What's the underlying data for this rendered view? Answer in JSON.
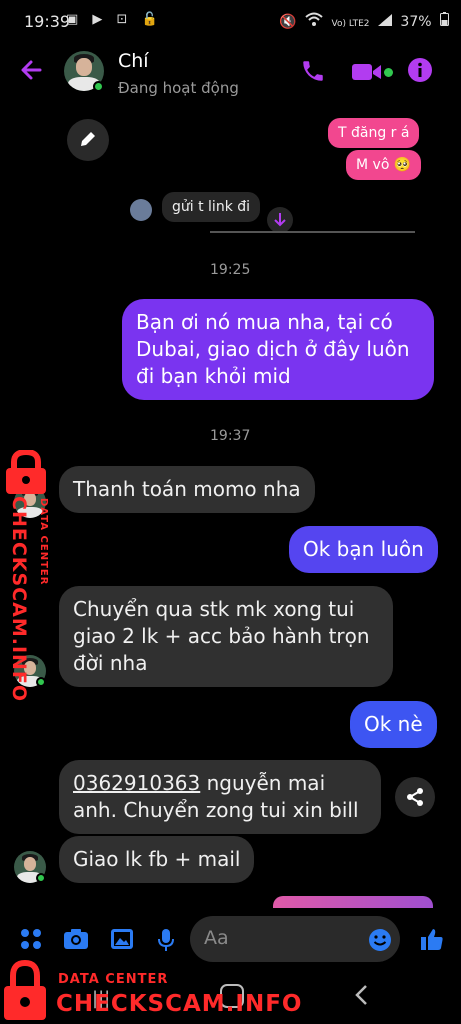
{
  "status_bar": {
    "time": "19:39",
    "network": "Vo) LTE2",
    "battery": "37%"
  },
  "header": {
    "contact_name": "Chí",
    "contact_status": "Đang hoạt động"
  },
  "messages": {
    "pink_1": "T đăng r á",
    "pink_2": "M vô 🥺",
    "small_in": "gửi t link đi",
    "time_1": "19:25",
    "out_1": "Bạn ơi nó mua nha, tại có Dubai, giao dịch ở đây luôn đi bạn khỏi mid",
    "time_2": "19:37",
    "in_1": "Thanh toán momo nha",
    "out_2": "Ok bạn luôn",
    "in_2": "Chuyển qua stk mk xong tui giao 2 lk + acc bảo hành trọn đời nha",
    "out_3": "Ok nè",
    "in_3_phone": "0362910363",
    "in_3_rest": " nguyễn mai anh. Chuyển zong tui xin bill",
    "in_4": "Giao lk fb + mail"
  },
  "composer": {
    "placeholder": "Aa"
  },
  "watermark": {
    "side_small": "DATA CENTER",
    "side_big": "CHECKSCAM.INFO",
    "bottom_small": "DATA CENTER",
    "bottom_big": "CHECKSCAM.INFO"
  },
  "colors": {
    "accent": "#b23cf0",
    "purple_bubble": "#7a34f0",
    "blue_bubble": "#3d55f2",
    "pink_bubble": "#f2478f",
    "incoming_bubble": "#303030",
    "watermark_red": "#ff2a2a",
    "online_green": "#31c74f"
  },
  "icons": {
    "back": "back-arrow-icon",
    "call": "phone-icon",
    "video": "video-camera-icon",
    "info": "info-icon",
    "edit": "pencil-icon",
    "scroll": "arrow-down-icon",
    "share": "share-icon",
    "menu": "grid-dots-icon",
    "camera": "camera-icon",
    "gallery": "image-icon",
    "mic": "microphone-icon",
    "emoji": "emoji-icon",
    "like": "thumbs-up-icon"
  }
}
